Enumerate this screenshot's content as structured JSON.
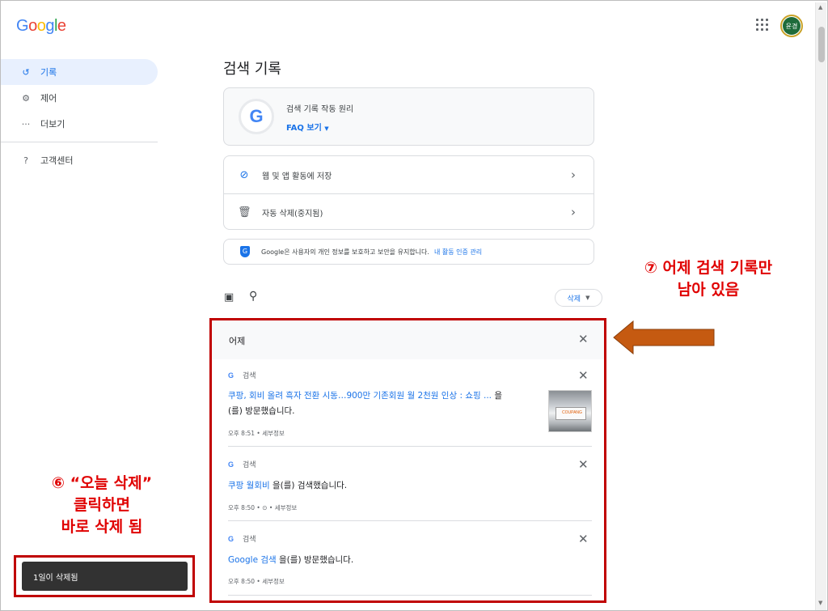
{
  "header": {
    "logo": "Google",
    "avatar_text": "윤경"
  },
  "sidebar": {
    "items": [
      {
        "icon": "history-icon",
        "label": "기록"
      },
      {
        "icon": "gear-icon",
        "label": "제어"
      },
      {
        "icon": "more-icon",
        "label": "더보기"
      },
      {
        "icon": "help-icon",
        "label": "고객센터"
      }
    ]
  },
  "main": {
    "title": "검색 기록",
    "faq": {
      "heading": "검색 기록 작동 원리",
      "link": "FAQ 보기"
    },
    "settings": [
      {
        "icon": "check-circle-icon",
        "label": "웹 및 앱 활동에 저장"
      },
      {
        "icon": "auto-delete-icon",
        "label": "자동 삭제(중지됨)"
      }
    ],
    "privacy": {
      "text": "Google은 사용자의 개인 정보를 보호하고 보안을 유지합니다.",
      "link": "내 활동 인증 관리"
    },
    "toolbar": {
      "delete_label": "삭제"
    }
  },
  "history": {
    "day_label": "어제",
    "entries": [
      {
        "source": "검색",
        "link": "쿠팡, 회비 올려 흑자 전환 시동…900만 기존회원 월 2천원 인상 : 쇼핑 ...",
        "text_after": " 을",
        "text_line2": "(를) 방문했습니다.",
        "time": "오후 8:51 • 세부정보",
        "thumb_text": "COUPANG"
      },
      {
        "source": "검색",
        "link": "쿠팡 월회비",
        "text_after": " 을(를) 검색했습니다.",
        "time": "오후 8:50 • ⊙ • 세부정보"
      },
      {
        "source": "검색",
        "link": "Google 검색",
        "text_after": " 을(를) 방문했습니다.",
        "time": "오후 8:50 • 세부정보"
      }
    ]
  },
  "toast": {
    "message": "1일이 삭제됨"
  },
  "annotations": {
    "step6": [
      "⑥ “오늘 삭제”",
      "클릭하면",
      "바로 삭제 됨"
    ],
    "step7": [
      "⑦ 어제 검색 기록만",
      "남아 있음"
    ]
  },
  "colors": {
    "accent": "#1a73e8",
    "annotation_red": "#e00000",
    "box_red": "#c00000",
    "arrow_orange": "#c55a11"
  }
}
